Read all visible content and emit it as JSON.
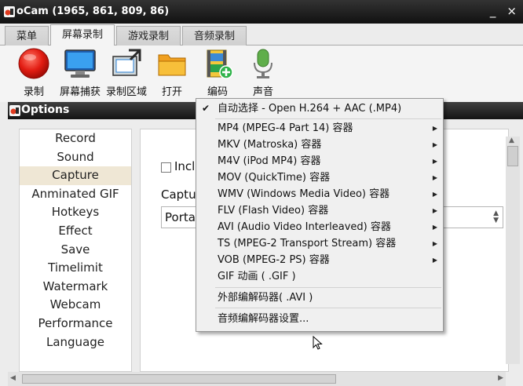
{
  "window": {
    "title": "oCam (1965, 861, 809, 86)",
    "controls": [
      "_",
      "×"
    ]
  },
  "tabs": [
    {
      "label": "菜单",
      "active": false
    },
    {
      "label": "屏幕录制",
      "active": true
    },
    {
      "label": "游戏录制",
      "active": false
    },
    {
      "label": "音频录制",
      "active": false
    }
  ],
  "toolbar": {
    "record": "录制",
    "screenshot": "屏幕捕获",
    "area": "录制区域",
    "open": "打开",
    "codec": "编码",
    "sound": "声音"
  },
  "options": {
    "title": "Options",
    "categories": [
      "Record",
      "Sound",
      "Capture",
      "Anminated GIF",
      "Hotkeys",
      "Effect",
      "Save",
      "Timelimit",
      "Watermark",
      "Webcam",
      "Performance",
      "Language"
    ],
    "selected_category": "Capture",
    "panel": {
      "checkbox_label": "Inclu",
      "capture_label": "Captur",
      "capture_value": "Portal"
    }
  },
  "codec_menu": {
    "items": [
      {
        "label": "自动选择 - Open H.264 + AAC (.MP4)",
        "checked": true,
        "submenu": false
      },
      {
        "label": "MP4 (MPEG-4 Part 14) 容器",
        "checked": false,
        "submenu": true
      },
      {
        "label": "MKV (Matroska) 容器",
        "checked": false,
        "submenu": true
      },
      {
        "label": "M4V (iPod MP4) 容器",
        "checked": false,
        "submenu": true
      },
      {
        "label": "MOV (QuickTime) 容器",
        "checked": false,
        "submenu": true
      },
      {
        "label": "WMV (Windows Media Video) 容器",
        "checked": false,
        "submenu": true
      },
      {
        "label": "FLV (Flash Video) 容器",
        "checked": false,
        "submenu": true
      },
      {
        "label": "AVI (Audio Video Interleaved) 容器",
        "checked": false,
        "submenu": true
      },
      {
        "label": "TS (MPEG-2 Transport Stream) 容器",
        "checked": false,
        "submenu": true
      },
      {
        "label": "VOB (MPEG-2 PS) 容器",
        "checked": false,
        "submenu": true
      },
      {
        "label": "GIF 动画 ( .GIF )",
        "checked": false,
        "submenu": false
      },
      {
        "label": "外部编解码器( .AVI )",
        "checked": false,
        "submenu": false
      },
      {
        "label": "音频编解码器设置...",
        "checked": false,
        "submenu": false
      }
    ],
    "check_glyph": "✔",
    "submenu_glyph": "▶"
  },
  "colors": {
    "record_red": "#e02020",
    "accent_blue": "#2a7fd4",
    "selection": "#efe7d5"
  }
}
